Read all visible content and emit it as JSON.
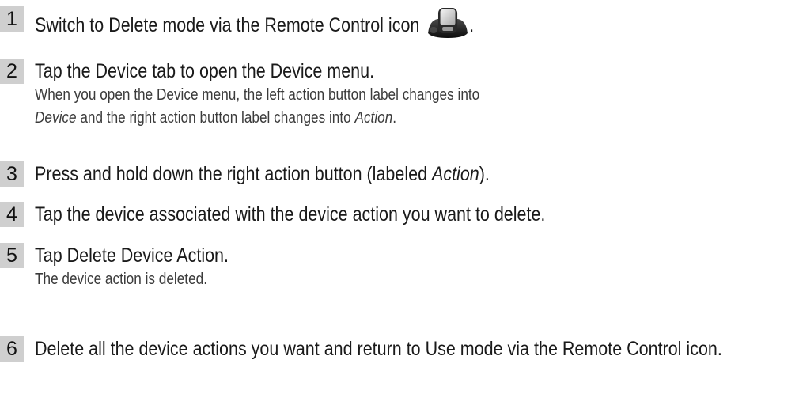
{
  "steps": [
    {
      "number": "1",
      "text": "Switch to Delete mode via the Remote Control icon",
      "icon": "remote-control-icon",
      "after_icon": "."
    },
    {
      "number": "2",
      "text": "Tap the Device tab to open the Device menu.",
      "note_line1": "When you open the Device menu, the left action button label changes into",
      "note_line2_em1": "Device",
      "note_line2_mid": " and the right action button label changes into ",
      "note_line2_em2": "Action",
      "note_line2_end": "."
    },
    {
      "number": "3",
      "text_before": "Press and hold down the right action button (labeled ",
      "text_em": "Action",
      "text_after": ")."
    },
    {
      "number": "4",
      "text": "Tap the device associated with the device action you want to delete."
    },
    {
      "number": "5",
      "text": "Tap Delete Device Action.",
      "note": "The device action is deleted."
    },
    {
      "number": "6",
      "text": "Delete all the device actions you want and return to Use mode via the Remote Control icon."
    }
  ]
}
